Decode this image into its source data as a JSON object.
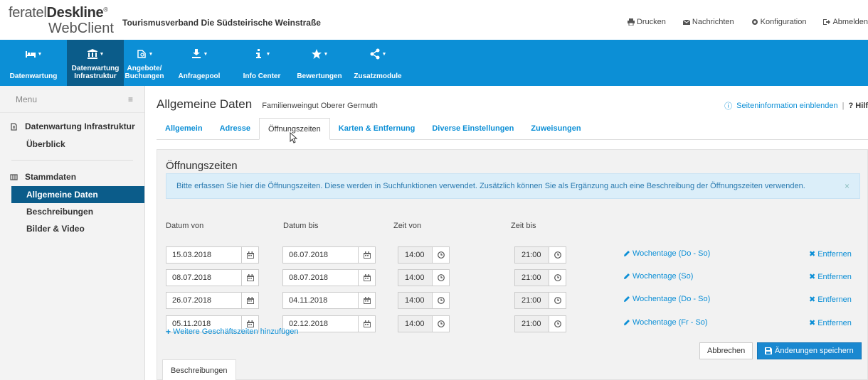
{
  "header": {
    "logo_prefix": "feratel",
    "logo_brand": "Deskline",
    "logo_reg": "®",
    "logo_sub": "WebClient",
    "org_title": "Tourismusverband Die Südsteirische Weinstraße",
    "links": [
      {
        "label": "Drucken",
        "icon": "print-icon"
      },
      {
        "label": "Nachrichten",
        "icon": "envelope-icon"
      },
      {
        "label": "Konfiguration",
        "icon": "gear-icon"
      },
      {
        "label": "Abmelden",
        "icon": "logout-icon"
      }
    ]
  },
  "nav": {
    "items": [
      {
        "label1": "",
        "label2": "Datenwartung",
        "icon": "bed-icon",
        "active": false
      },
      {
        "label1": "Datenwartung",
        "label2": "Infrastruktur",
        "icon": "institution-icon",
        "active": true
      },
      {
        "label1": "Angebote/",
        "label2": "Buchungen",
        "icon": "suitcase-icon",
        "active": false
      },
      {
        "label1": "",
        "label2": "Anfragepool",
        "icon": "inbox-icon",
        "active": false
      },
      {
        "label1": "",
        "label2": "Info Center",
        "icon": "info-icon",
        "active": false
      },
      {
        "label1": "",
        "label2": "Bewertungen",
        "icon": "star-icon",
        "active": false
      },
      {
        "label1": "",
        "label2": "Zusatzmodule",
        "icon": "share-icon",
        "active": false
      }
    ]
  },
  "sidebar": {
    "menu_label": "Menu",
    "sections": [
      {
        "title": "Datenwartung Infrastruktur",
        "items": [
          "Überblick"
        ]
      },
      {
        "title": "Stammdaten",
        "items": [
          "Allgemeine Daten",
          "Beschreibungen",
          "Bilder & Video"
        ]
      }
    ],
    "active_item": "Allgemeine Daten"
  },
  "main": {
    "title": "Allgemeine Daten",
    "subtitle": "Familienweingut Oberer Germuth",
    "info_link": "Seiteninformation einblenden",
    "help_link": "? Hilf",
    "tabs": [
      "Allgemein",
      "Adresse",
      "Öffnungszeiten",
      "Karten & Entfernung",
      "Diverse Einstellungen",
      "Zuweisungen"
    ],
    "active_tab": "Öffnungszeiten",
    "panel_title": "Öffnungszeiten",
    "alert_text": "Bitte erfassen Sie hier die Öffnungszeiten. Diese werden in Suchfunktionen verwendet. Zusätzlich können Sie als Ergänzung auch eine Beschreibung der Öffnungszeiten verwenden.",
    "alert_close": "×",
    "columns": {
      "date_from": "Datum von",
      "date_to": "Datum bis",
      "time_from": "Zeit von",
      "time_to": "Zeit bis"
    },
    "rows": [
      {
        "from": "15.03.2018",
        "to": "06.07.2018",
        "tfrom": "14:00",
        "tto": "21:00",
        "weekdays": "Wochentage (Do - So)",
        "remove": "Entfernen"
      },
      {
        "from": "08.07.2018",
        "to": "08.07.2018",
        "tfrom": "14:00",
        "tto": "21:00",
        "weekdays": "Wochentage (So)",
        "remove": "Entfernen"
      },
      {
        "from": "26.07.2018",
        "to": "04.11.2018",
        "tfrom": "14:00",
        "tto": "21:00",
        "weekdays": "Wochentage (Do - So)",
        "remove": "Entfernen"
      },
      {
        "from": "05.11.2018",
        "to": "02.12.2018",
        "tfrom": "14:00",
        "tto": "21:00",
        "weekdays": "Wochentage (Fr - So)",
        "remove": "Entfernen"
      }
    ],
    "add_more": "Weitere Geschäftszeiten hinzufügen",
    "cancel_label": "Abbrechen",
    "save_label": "Änderungen speichern",
    "sub_tab": "Beschreibungen"
  }
}
